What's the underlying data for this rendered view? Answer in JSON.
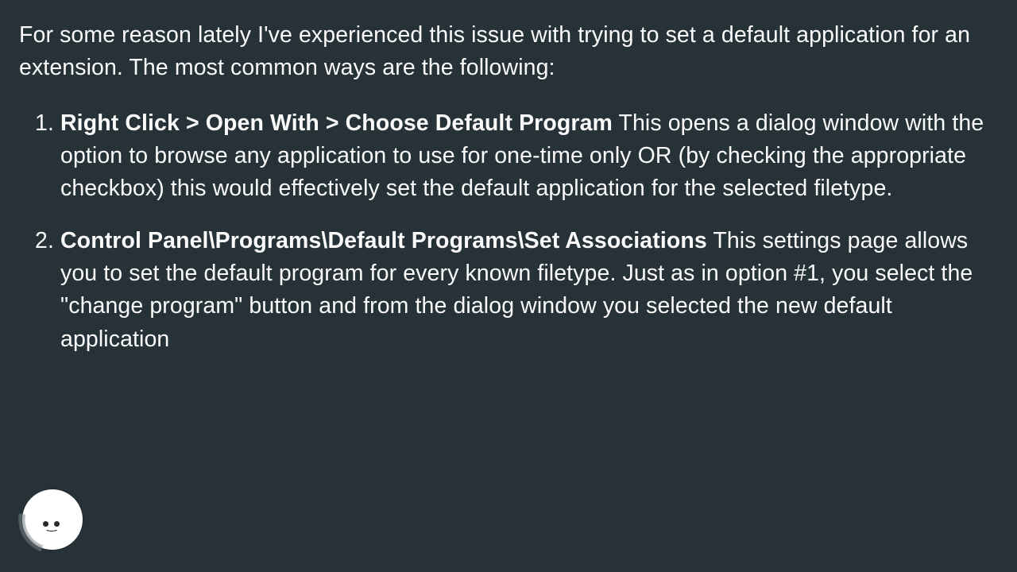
{
  "intro": "For some reason lately I've experienced this issue with trying to set a default application for an extension. The most common ways are the following:",
  "items": [
    {
      "bold": "Right Click > Open With > Choose Default Program",
      "rest": " This opens a dialog window with the option to browse any application to use for one-time only OR (by checking the appropriate checkbox) this would effectively set the default application for the selected filetype."
    },
    {
      "bold": "Control Panel\\Programs\\Default Programs\\Set Associations",
      "rest": " This settings page allows you to set the default program for every known filetype. Just as in option #1, you select the \"change program\" button and from the dialog window you selected the new default application"
    }
  ],
  "avatar": {
    "name": "assistant-avatar"
  }
}
